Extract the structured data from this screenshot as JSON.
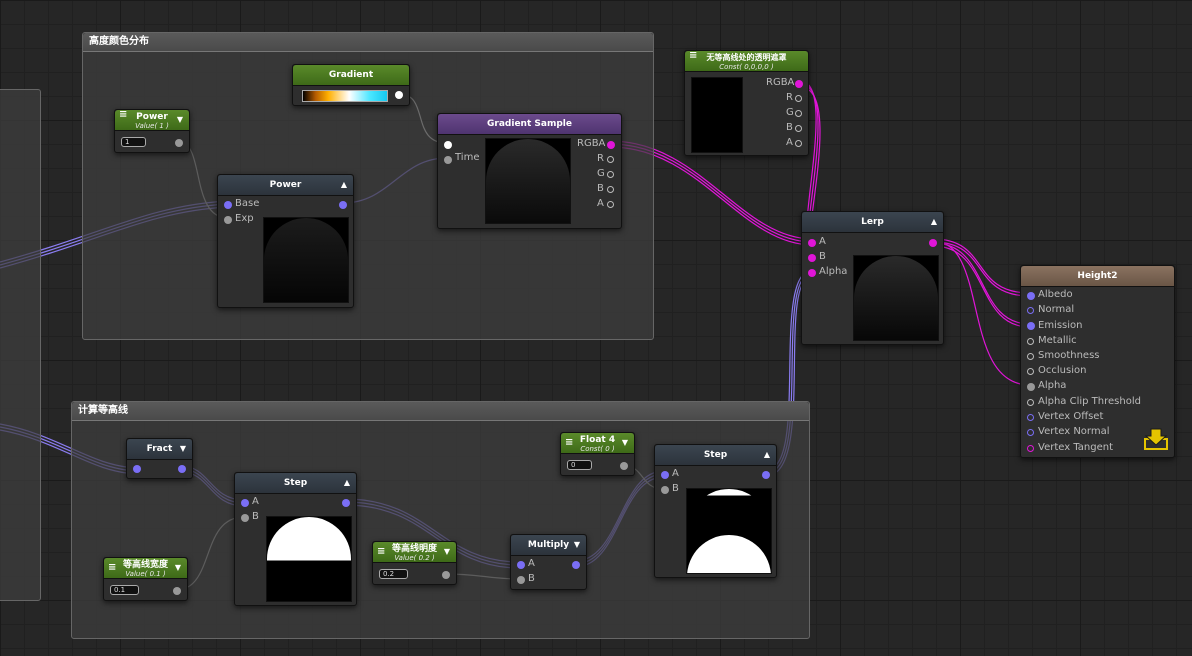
{
  "groups": {
    "height_color": {
      "title": "高度颜色分布"
    },
    "contour": {
      "title": "计算等高线"
    }
  },
  "nodes": {
    "power_value": {
      "title": "Power",
      "subtitle": "Value( 1 )",
      "value": "1"
    },
    "gradient": {
      "title": "Gradient"
    },
    "gradient_sample": {
      "title": "Gradient Sample",
      "inputs": [
        "Time"
      ],
      "outputs": [
        "RGBA",
        "R",
        "G",
        "B",
        "A"
      ]
    },
    "power": {
      "title": "Power",
      "inputs": [
        "Base",
        "Exp"
      ]
    },
    "mask_const": {
      "title": "无等高线处的透明遮罩",
      "subtitle": "Const( 0,0,0,0 )",
      "outputs": [
        "RGBA",
        "R",
        "G",
        "B",
        "A"
      ]
    },
    "lerp": {
      "title": "Lerp",
      "inputs": [
        "A",
        "B",
        "Alpha"
      ]
    },
    "height2": {
      "title": "Height2",
      "inputs": [
        "Albedo",
        "Normal",
        "Emission",
        "Metallic",
        "Smoothness",
        "Occlusion",
        "Alpha",
        "Alpha Clip Threshold",
        "Vertex Offset",
        "Vertex Normal",
        "Vertex Tangent"
      ]
    },
    "fract": {
      "title": "Fract"
    },
    "step1": {
      "title": "Step",
      "inputs": [
        "A",
        "B"
      ]
    },
    "step2": {
      "title": "Step",
      "inputs": [
        "A",
        "B"
      ]
    },
    "width_value": {
      "title": "等高线宽度",
      "subtitle": "Value( 0.1 )",
      "value": "0.1"
    },
    "brightness_value": {
      "title": "等高线明度",
      "subtitle": "Value( 0.2 )",
      "value": "0.2"
    },
    "multiply": {
      "title": "Multiply",
      "inputs": [
        "A",
        "B"
      ]
    },
    "float4": {
      "title": "Float 4",
      "subtitle": "Const( 0 )",
      "value": "0"
    }
  },
  "icons": {
    "menu": "hamburger-icon",
    "collapse": "triangle-icon",
    "save": "save-download-icon"
  },
  "colors": {
    "wire": "#8a7cf0",
    "wire_magenta": "#e015d8",
    "port_blue": "#7a6ef5",
    "save_icon": "#e5c400"
  }
}
